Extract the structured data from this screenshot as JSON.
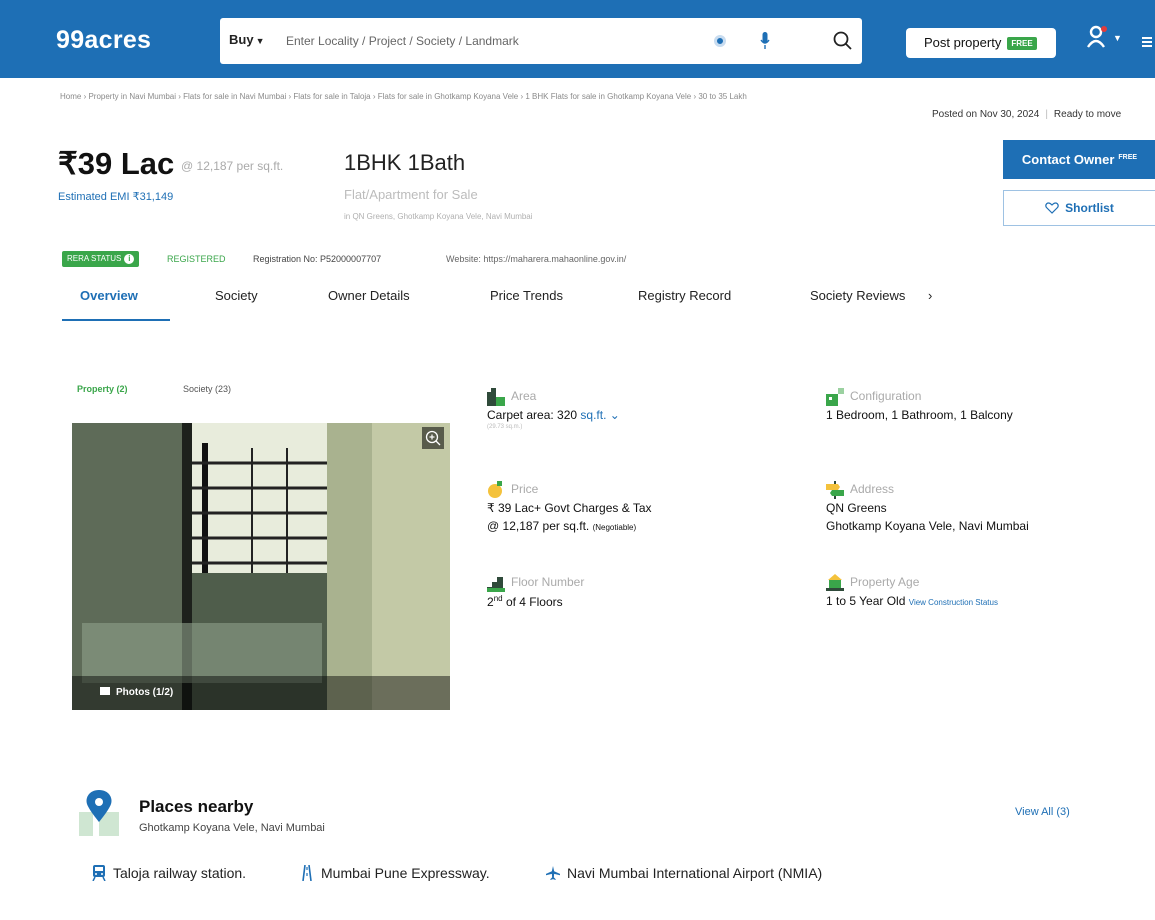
{
  "header": {
    "logo": "99acres",
    "buy_label": "Buy",
    "search_placeholder": "Enter Locality / Project / Society / Landmark",
    "post_property_label": "Post property",
    "post_property_badge": "FREE"
  },
  "breadcrumb": "Home › Property in Navi Mumbai › Flats for sale in Navi Mumbai › Flats for sale in Taloja › Flats for sale in Ghotkamp Koyana Vele › 1 BHK Flats for sale in Ghotkamp Koyana Vele › 30 to 35 Lakh",
  "posted": {
    "date": "Posted on Nov 30, 2024",
    "status": "Ready to move"
  },
  "listing": {
    "price": "₹39 Lac",
    "price_per_sqft": "@ 12,187 per sq.ft.",
    "emi": "Estimated EMI ₹31,149",
    "title": "1BHK 1Bath",
    "subtitle": "Flat/Apartment for Sale",
    "address": "in QN Greens, Ghotkamp Koyana Vele, Navi Mumbai",
    "contact_label": "Contact Owner",
    "contact_badge": "FREE",
    "shortlist_label": "Shortlist"
  },
  "rera": {
    "badge": "RERA STATUS",
    "status": "REGISTERED",
    "registration": "Registration No: P52000007707",
    "website": "Website: https://maharera.mahaonline.gov.in/"
  },
  "tabs": [
    "Overview",
    "Society",
    "Owner Details",
    "Price Trends",
    "Registry Record",
    "Society Reviews"
  ],
  "media": {
    "tab_property": "Property (2)",
    "tab_society": "Society (23)",
    "photos_label": "Photos (1/2)"
  },
  "details": {
    "area": {
      "label": "Area",
      "value_prefix": "Carpet area: 320",
      "unit": "sq.ft.",
      "sub": "(29.73 sq.m.)"
    },
    "configuration": {
      "label": "Configuration",
      "value": "1 Bedroom, 1 Bathroom, 1 Balcony"
    },
    "price": {
      "label": "Price",
      "line1": "₹ 39 Lac+ Govt Charges & Tax",
      "line2": "@ 12,187 per sq.ft.",
      "negotiable": "(Negotiable)"
    },
    "address": {
      "label": "Address",
      "line1": "QN Greens",
      "line2": "Ghotkamp Koyana Vele, Navi Mumbai"
    },
    "floor": {
      "label": "Floor Number",
      "floor": "2",
      "suffix": "nd",
      "of": "of 4 Floors"
    },
    "age": {
      "label": "Property Age",
      "value": "1 to 5 Year Old",
      "link": "View Construction Status"
    }
  },
  "places": {
    "title": "Places nearby",
    "subtitle": "Ghotkamp Koyana Vele, Navi Mumbai",
    "view_all": "View All (3)",
    "items": [
      "Taloja railway station.",
      "Mumbai Pune Expressway.",
      "Navi Mumbai International Airport (NMIA)"
    ]
  },
  "colors": {
    "brand": "#1e6fb5",
    "green": "#3aa64a"
  }
}
